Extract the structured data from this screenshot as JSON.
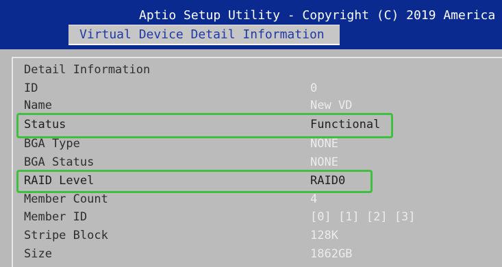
{
  "header": {
    "app_title": "Aptio Setup Utility - Copyright (C) 2019 America",
    "tab_label": "Virtual Device Detail Information"
  },
  "panel": {
    "section_title": "Detail Information",
    "rows": [
      {
        "label": "ID",
        "value": "0"
      },
      {
        "label": "Name",
        "value": "New VD"
      },
      {
        "label": "Status",
        "value": "Functional"
      },
      {
        "label": "BGA Type",
        "value": "NONE"
      },
      {
        "label": "BGA Status",
        "value": "NONE"
      },
      {
        "label": "RAID Level",
        "value": "RAID0"
      },
      {
        "label": "Member Count",
        "value": "4"
      },
      {
        "label": "Member ID",
        "value": "[0] [1] [2] [3]"
      },
      {
        "label": "Stripe Block",
        "value": "128K"
      },
      {
        "label": "Size",
        "value": "1862GB"
      }
    ]
  },
  "colors": {
    "header_bg": "#0a2a8f",
    "panel_bg": "#bbbbbb",
    "highlight_border": "#3fbf3f",
    "value_text": "#ececec"
  }
}
